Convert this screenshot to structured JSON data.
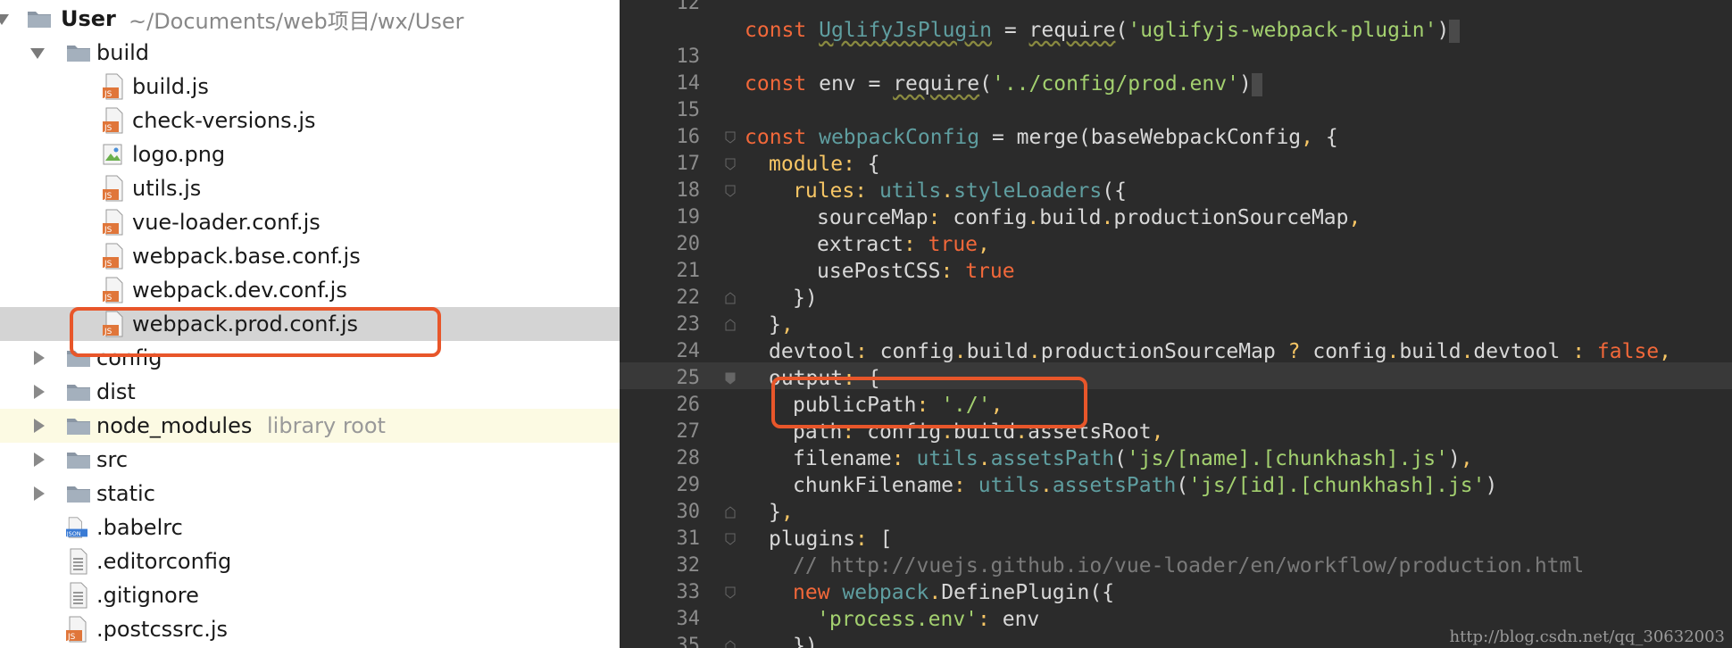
{
  "project": {
    "root_name": "User",
    "root_path": "~/Documents/web项目/wx/User"
  },
  "tree": {
    "build_folder": "build",
    "build_files": [
      {
        "name": "build.js",
        "icon": "js-file-icon"
      },
      {
        "name": "check-versions.js",
        "icon": "js-file-icon"
      },
      {
        "name": "logo.png",
        "icon": "image-file-icon"
      },
      {
        "name": "utils.js",
        "icon": "js-file-icon"
      },
      {
        "name": "vue-loader.conf.js",
        "icon": "js-file-icon"
      },
      {
        "name": "webpack.base.conf.js",
        "icon": "js-file-icon"
      },
      {
        "name": "webpack.dev.conf.js",
        "icon": "js-file-icon"
      },
      {
        "name": "webpack.prod.conf.js",
        "icon": "js-file-icon"
      }
    ],
    "folders": [
      "config",
      "dist",
      "node_modules",
      "src",
      "static"
    ],
    "library_root_label": "library root",
    "root_files": [
      {
        "name": ".babelrc",
        "icon": "json-file-icon"
      },
      {
        "name": ".editorconfig",
        "icon": "text-file-icon"
      },
      {
        "name": ".gitignore",
        "icon": "text-file-icon"
      },
      {
        "name": ".postcssrc.js",
        "icon": "js-file-icon"
      }
    ]
  },
  "editor": {
    "line_numbers": [
      "12",
      "13",
      "14",
      "15",
      "16",
      "17",
      "18",
      "19",
      "20",
      "21",
      "22",
      "23",
      "24",
      "25",
      "26",
      "27",
      "28",
      "29",
      "30",
      "31",
      "32",
      "33",
      "34",
      "35"
    ],
    "current_line": "25",
    "comment_url": "// http://vuejs.github.io/vue-loader/en/workflow/production.html"
  },
  "watermark": "http://blog.csdn.net/qq_30632003",
  "colors": {
    "highlight": "#e8562a",
    "editor_bg": "#2b2b2b",
    "selected_row": "#d4d4d4"
  }
}
